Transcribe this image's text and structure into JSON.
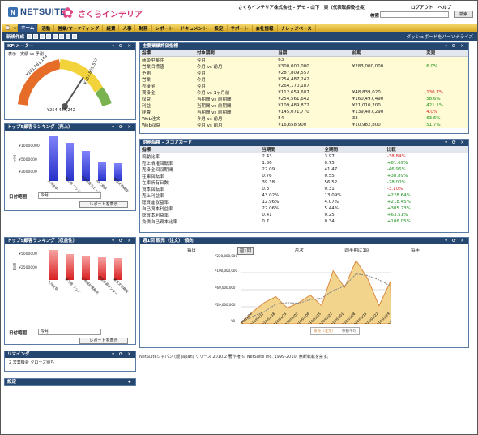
{
  "header": {
    "logo_text": "NETSUITE",
    "brand": "さくらインテリア",
    "company": "さくらインテリア株式会社 - デモ - 山下　東（代表取締役社長）",
    "links": [
      "ログアウト",
      "ヘルプ"
    ],
    "search_label": "検索",
    "search_button": "検索"
  },
  "nav": {
    "items": [
      "ホーム",
      "活動",
      "営業/マーケティング",
      "経費",
      "人事",
      "財務",
      "レポート",
      "ドキュメント",
      "設定",
      "サポート",
      "会社情報",
      "ナレッジベース"
    ]
  },
  "subnav": {
    "left": "新規作成",
    "right": "ダッシュボードをパーソナライズ"
  },
  "kpi_meter": {
    "title": "KPIメーター",
    "mode": "表示　実績 vs 予測",
    "value": "¥254,487,242",
    "left_label": "¥161,181,144",
    "right_label": "¥287,809,557"
  },
  "rank_sales": {
    "title": "トップ5顧客ランキング（売上）",
    "date_label": "日付範囲",
    "date_value": "今月",
    "button": "レポートを表示",
    "ylabels": [
      "¥10000000",
      "¥5000000",
      "¥3000000"
    ],
    "axis": "売上",
    "categories": [
      "九州大学",
      "夢工房 ウッド",
      "A社自販チェーン",
      "ABC家具",
      "東京大学病院"
    ]
  },
  "rank_profit": {
    "title": "トップ5顧客ランキング（収益性）",
    "date_label": "日付範囲",
    "date_value": "今月",
    "button": "レポートを表示",
    "ylabels": [
      "¥5000000",
      "¥2500000"
    ],
    "axis": "利益",
    "categories": [
      "九州大学",
      "夢工房 ウッド",
      "住宅設計事務所",
      "東京家具センター",
      "東京大学病院"
    ]
  },
  "reminder": {
    "title": "リマインダ",
    "item": "2 営業機会 クローズ待ち"
  },
  "settings": {
    "title": "設定"
  },
  "kpi_table": {
    "title": "主要業績評価指標",
    "columns": [
      "指標",
      "対象期間",
      "当期",
      "前期",
      "変更"
    ],
    "rows": [
      [
        "商談中案件",
        "今月",
        "63",
        "",
        ""
      ],
      [
        "営業目標値",
        "今月 vs 前月",
        "¥300,000,000",
        "¥283,000,000",
        "6.0%"
      ],
      [
        "予測",
        "今月",
        "¥287,809,557",
        "",
        ""
      ],
      [
        "営業",
        "今月",
        "¥254,487,242",
        "",
        ""
      ],
      [
        "売掛金",
        "今月",
        "¥264,170,187",
        "",
        ""
      ],
      [
        "買掛金",
        "今月 vs 1ヶ月前",
        "¥112,659,687",
        "¥48,839,020",
        "130.7%"
      ],
      [
        "収益",
        "当期間 vs 前期間",
        "¥254,561,642",
        "¥160,497,490",
        "58.6%"
      ],
      [
        "利益",
        "当期間 vs 前期間",
        "¥109,489,872",
        "¥21,010,200",
        "421.1%"
      ],
      [
        "経費",
        "当期間 vs 前期間",
        "¥145,071,770",
        "¥139,487,290",
        "4.0%"
      ],
      [
        "Web注文",
        "今月 vs 前月",
        "54",
        "33",
        "63.6%"
      ],
      [
        "Web収益",
        "今月 vs 前月",
        "¥16,658,900",
        "¥10,982,800",
        "51.7%"
      ]
    ]
  },
  "scorecard": {
    "title": "財務指標 - スコアカード",
    "columns": [
      "指標",
      "当期間",
      "全期間",
      "比較"
    ],
    "rows": [
      [
        "流動比率",
        "2.43",
        "3.97",
        "-38.84%"
      ],
      [
        "売上債権回転率",
        "1.36",
        "0.75",
        "+81.69%"
      ],
      [
        "売掛金回収期間",
        "22.09",
        "41.47",
        "-46.96%"
      ],
      [
        "在庫回転率",
        "0.76",
        "0.55",
        "+38.89%"
      ],
      [
        "在庫所有日数",
        "39.38",
        "56.52",
        "-28.00%"
      ],
      [
        "資本回転率",
        "0.3",
        "0.31",
        "-3.10%"
      ],
      [
        "売上利益率",
        "43.02%",
        "13.09%",
        "+228.64%"
      ],
      [
        "総資産収益率",
        "12.96%",
        "4.07%",
        "+218.45%"
      ],
      [
        "自己資本利益率",
        "22.06%",
        "5.44%",
        "+305.23%"
      ],
      [
        "総資本利益率",
        "0.41",
        "0.25",
        "+63.51%"
      ],
      [
        "負債自己資本比率",
        "0.7",
        "0.34",
        "+106.05%"
      ]
    ]
  },
  "trend": {
    "title": "週1回 販売（注文） 傾向",
    "tabs": [
      "毎日",
      "週1回",
      "月次",
      "四半期に1回",
      "毎年"
    ],
    "active": "週1回",
    "yticks": [
      "¥220,000,000",
      "¥100,000,000",
      "¥60,000,000",
      "¥20,000,000",
      "¥0"
    ],
    "legend": [
      "販売（注文）",
      "移動平均"
    ]
  },
  "chart_data": {
    "type": "area",
    "x": [
      "2010/01/04",
      "2010/01/11",
      "2010/01/18",
      "2010/01/25",
      "2010/02/01",
      "2010/02/08",
      "2010/02/15",
      "2010/02/22",
      "2010/03/01",
      "2010/03/08",
      "2010/03/15",
      "2010/03/22",
      "2010/03/29",
      "2010/04/05"
    ],
    "series": [
      {
        "name": "販売（注文）",
        "values": [
          5,
          40,
          70,
          90,
          52,
          70,
          95,
          60,
          175,
          120,
          210,
          150,
          60,
          140
        ]
      },
      {
        "name": "移動平均",
        "values": [
          5,
          25,
          40,
          65,
          70,
          68,
          80,
          85,
          110,
          125,
          165,
          160,
          145,
          125
        ]
      }
    ],
    "ylim": [
      0,
      220
    ],
    "ylabel": ""
  },
  "footer": "NetSuiteジャパン (版 Japan) リリース 2010.2 著作権 © NetSuite Inc. 1999-2010. 無断転載を禁ず。"
}
